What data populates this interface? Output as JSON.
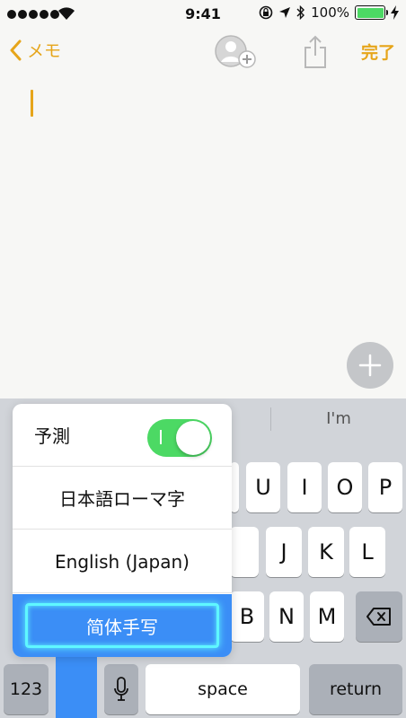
{
  "status_bar": {
    "time": "9:41",
    "battery_percent": "100%",
    "battery_level": 1.0
  },
  "nav": {
    "back_label": "メモ",
    "done_label": "完了"
  },
  "keyboard": {
    "suggestions": [
      "",
      "",
      "I'm"
    ],
    "rows": {
      "top_visible": [
        "U",
        "I",
        "O",
        "P"
      ],
      "middle_visible": [
        "J",
        "K",
        "L"
      ],
      "bottom_visible": [
        "B",
        "N",
        "M"
      ]
    },
    "numbers_label": "123",
    "space_label": "space",
    "return_label": "return"
  },
  "language_menu": {
    "predict_label": "予測",
    "predict_on": true,
    "options": [
      "日本語ローマ字",
      "English (Japan)"
    ],
    "selected": "简体手写"
  },
  "colors": {
    "accent": "#e6a51a",
    "toggle_on": "#4cd964",
    "selection": "#3b8ef6",
    "focus_ring": "#5ff7ff"
  }
}
